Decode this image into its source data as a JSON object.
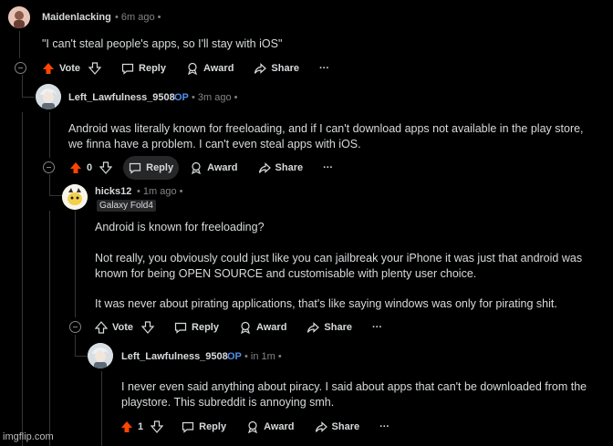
{
  "comments": [
    {
      "username": "Maidenlacking",
      "time": "6m ago",
      "body": "\"I can't steal people's apps, so I'll stay with iOS\"",
      "actions": {
        "vote": "Vote",
        "reply": "Reply",
        "award": "Award",
        "share": "Share",
        "more": "···"
      }
    },
    {
      "username": "Left_Lawfulness_9508",
      "op": "OP",
      "time": "3m ago",
      "body_lines": [
        "Android was literally known for freeloading, and if I can't download apps not available in the play store,",
        "we finna have a problem. I can't even steal apps with iOS."
      ],
      "actions": {
        "vote": "0",
        "reply": "Reply",
        "award": "Award",
        "share": "Share",
        "more": "···"
      }
    },
    {
      "username": "hicks12",
      "time": "1m ago",
      "flair": "Galaxy Fold4",
      "paragraphs": [
        "Android is known for freeloading?",
        "Not really, you obviously could just like you can jailbreak your iPhone it was just that android was",
        "known for being OPEN SOURCE and customisable with plenty user choice.",
        "It was never about pirating applications, that's like saying windows was only for pirating shit."
      ],
      "actions": {
        "vote": "Vote",
        "reply": "Reply",
        "award": "Award",
        "share": "Share",
        "more": "···"
      }
    },
    {
      "username": "Left_Lawfulness_9508",
      "op": "OP",
      "time": "in 1m",
      "body_lines": [
        "I never even said anything about piracy. I said about apps that can't be downloaded from the",
        "playstore. This subreddit is annoying smh."
      ],
      "actions": {
        "vote": "1",
        "reply": "Reply",
        "award": "Award",
        "share": "Share",
        "more": "···"
      }
    }
  ],
  "watermark": "imgflip.com",
  "colors": {
    "upvote": "#ff4500",
    "op": "#4f8fe6",
    "text": "#d7dadc",
    "muted": "#818384",
    "background": "#000000"
  }
}
